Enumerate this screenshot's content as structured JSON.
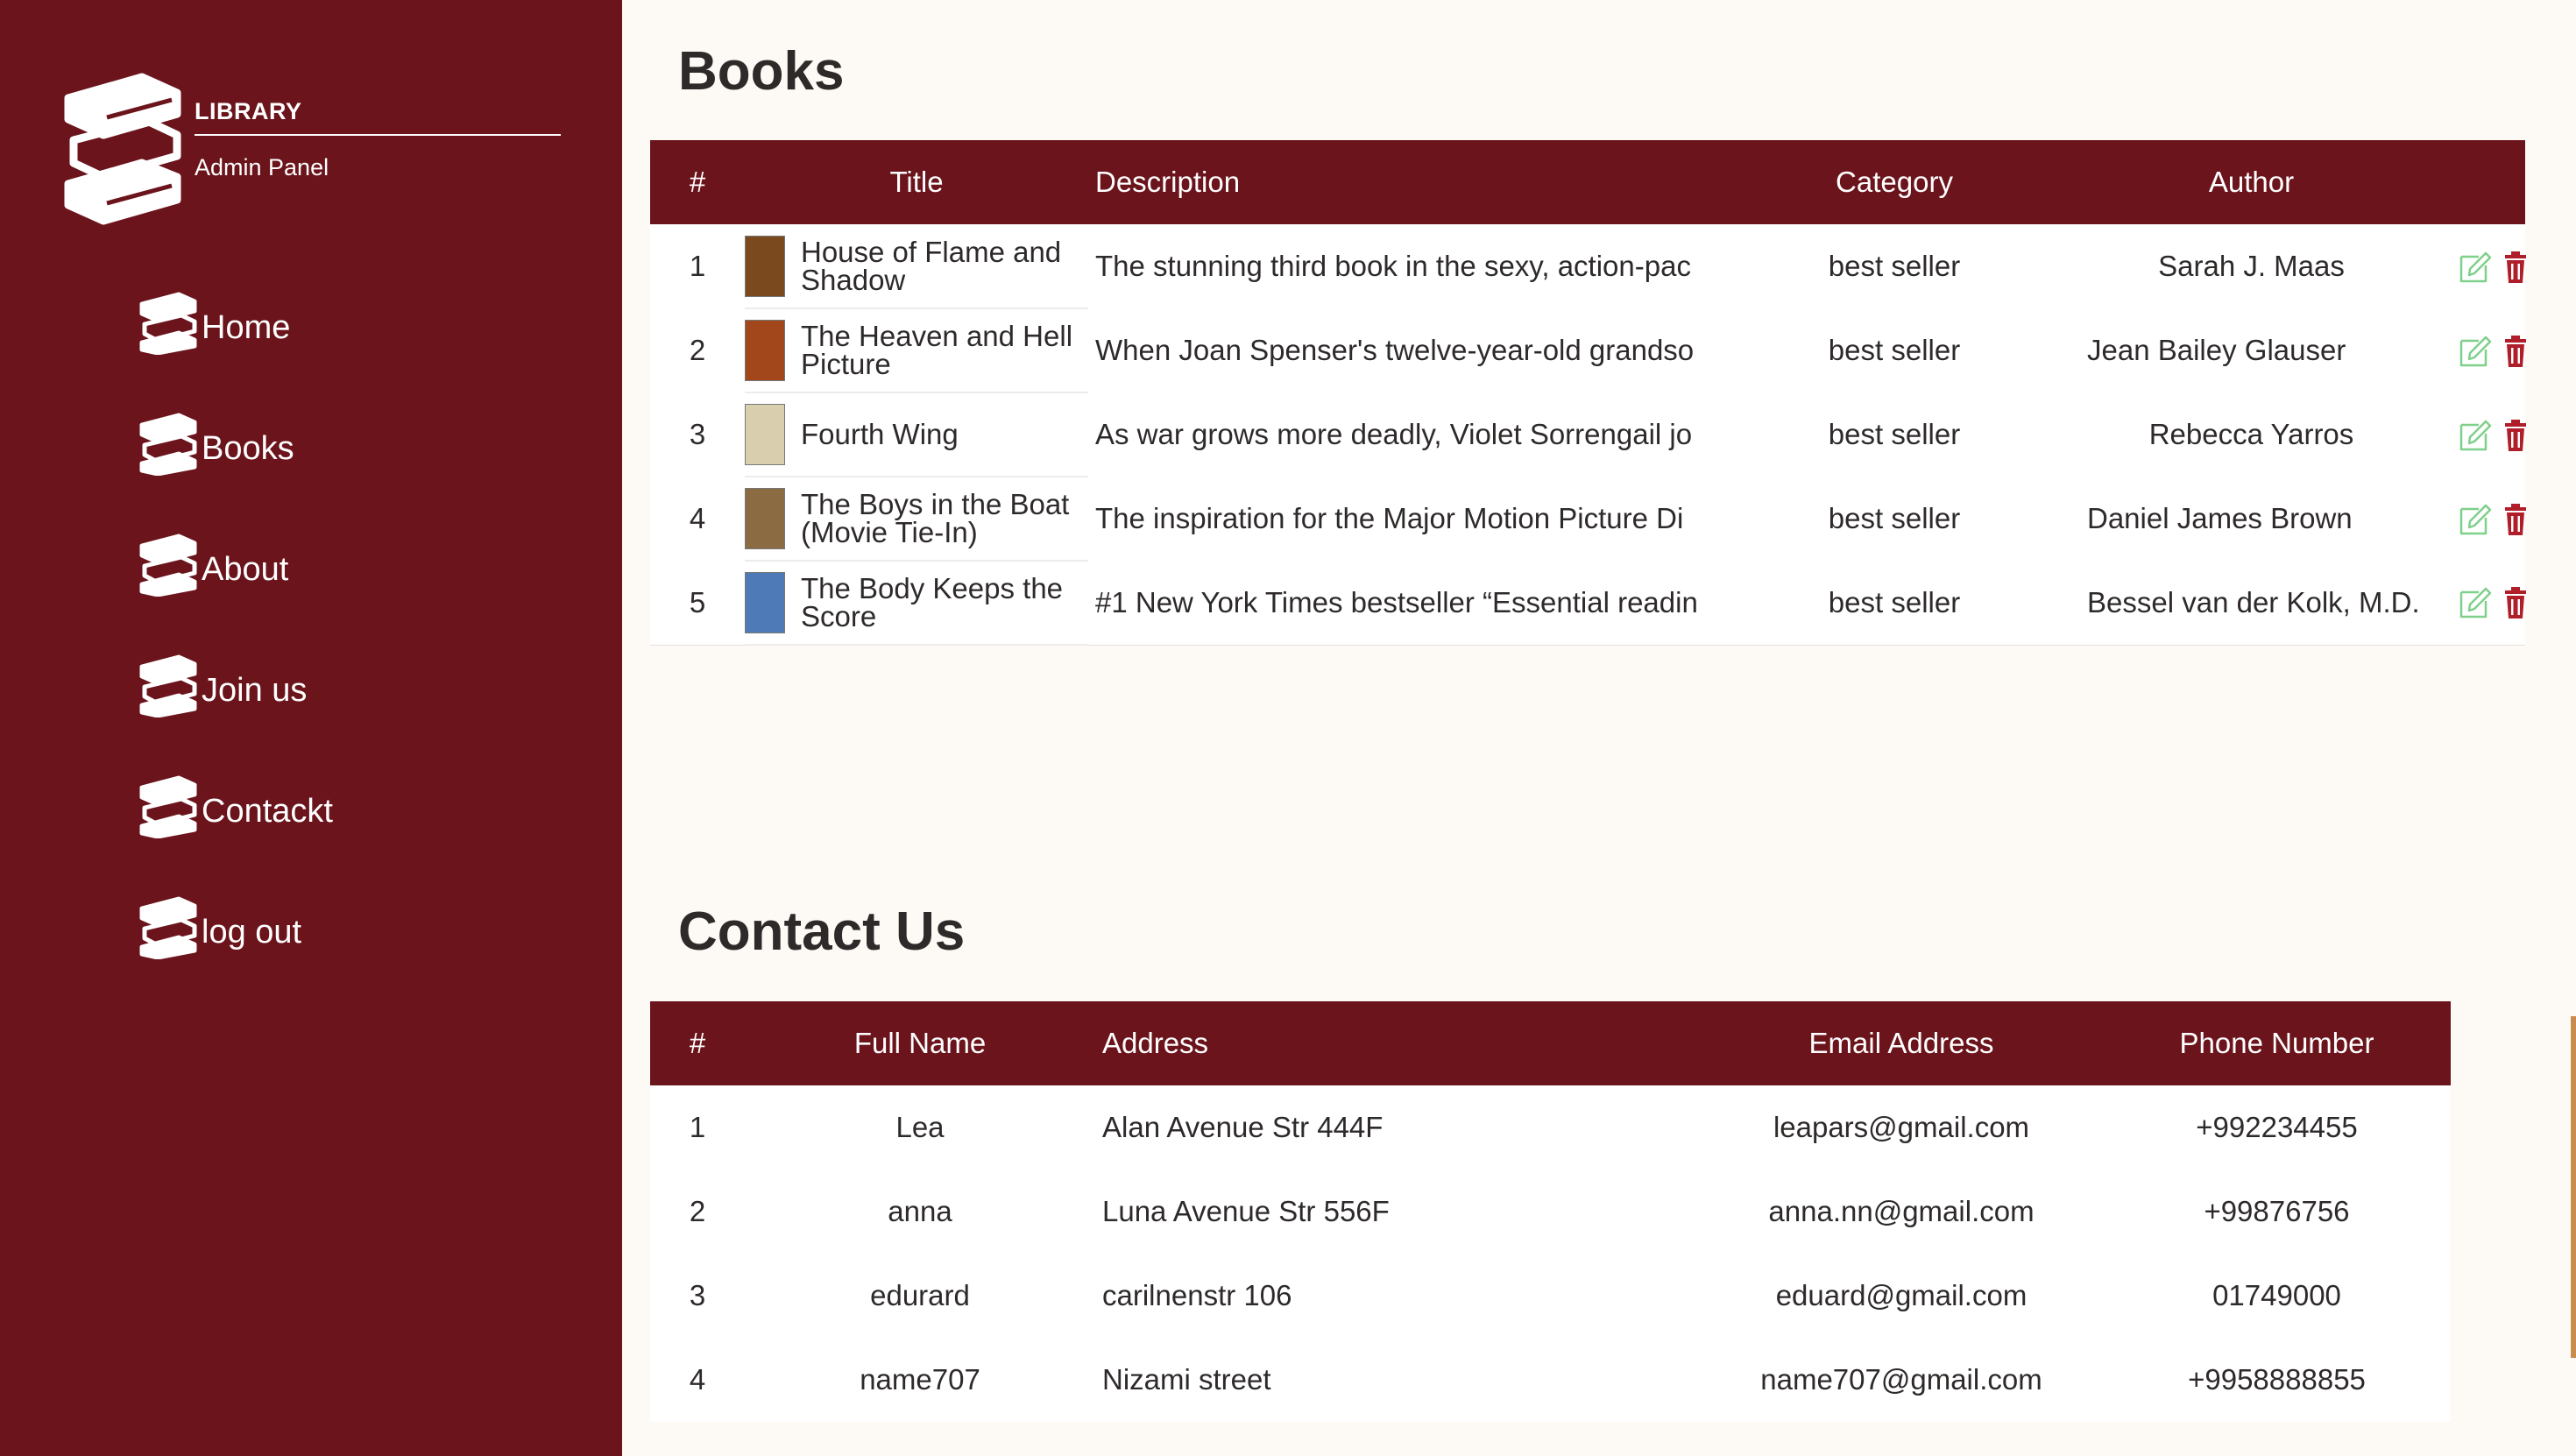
{
  "sidebar": {
    "brand_title": "LIBRARY",
    "brand_subtitle": "Admin Panel",
    "items": [
      {
        "label": "Home"
      },
      {
        "label": "Books"
      },
      {
        "label": "About"
      },
      {
        "label": "Join us"
      },
      {
        "label": "Contackt"
      },
      {
        "label": "log out"
      }
    ]
  },
  "books": {
    "title": "Books",
    "headers": [
      "#",
      "Title",
      "Description",
      "Category",
      "Author"
    ],
    "rows": [
      {
        "num": "1",
        "title": "House of Flame and Shadow",
        "description": "The stunning third book in the sexy, action-pac",
        "category": "best seller",
        "author": "Sarah J. Maas",
        "cover_color": "#7a4a1e"
      },
      {
        "num": "2",
        "title": "The Heaven and Hell Picture",
        "description": "When Joan Spenser's twelve-year-old grandso",
        "category": "best seller",
        "author": "Jean Bailey Glauser",
        "cover_color": "#a2461c"
      },
      {
        "num": "3",
        "title": "Fourth Wing",
        "description": "As war grows more deadly, Violet Sorrengail jo",
        "category": "best seller",
        "author": "Rebecca Yarros",
        "cover_color": "#d9cfae"
      },
      {
        "num": "4",
        "title": "The Boys in the Boat (Movie Tie-In)",
        "description": "The inspiration for the Major Motion Picture Di",
        "category": "best seller",
        "author": "Daniel James Brown",
        "cover_color": "#8b6b42"
      },
      {
        "num": "5",
        "title": "The Body Keeps the Score",
        "description": "#1 New York Times bestseller “Essential readin",
        "category": "best seller",
        "author": "Bessel van der Kolk, M.D.",
        "cover_color": "#4f7ab8"
      }
    ]
  },
  "contacts": {
    "title": "Contact Us",
    "headers": [
      "#",
      "Full Name",
      "Address",
      "Email Address",
      "Phone Number"
    ],
    "rows": [
      {
        "num": "1",
        "name": "Lea",
        "address": "Alan Avenue Str 444F",
        "email": "leapars@gmail.com",
        "phone": "+992234455"
      },
      {
        "num": "2",
        "name": "anna",
        "address": "Luna Avenue Str 556F",
        "email": "anna.nn@gmail.com",
        "phone": "+99876756"
      },
      {
        "num": "3",
        "name": "edurard",
        "address": "carilnenstr 106",
        "email": "eduard@gmail.com",
        "phone": "01749000"
      },
      {
        "num": "4",
        "name": "name707",
        "address": "Nizami street",
        "email": "name707@gmail.com",
        "phone": "+9958888855"
      }
    ]
  },
  "colors": {
    "brand": "#6b141c",
    "background": "#fdf9f5",
    "edit_icon": "#7fd08a",
    "delete_icon": "#b01e2a"
  },
  "icons": {
    "logo": "stacked-books-icon",
    "nav": "stacked-books-icon",
    "edit": "pencil-edit-icon",
    "delete": "trash-icon"
  }
}
